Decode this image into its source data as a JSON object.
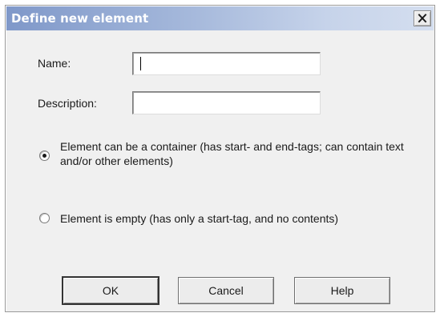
{
  "dialog": {
    "title": "Define new element"
  },
  "form": {
    "name_label": "Name:",
    "name_value": "",
    "description_label": "Description:",
    "description_value": ""
  },
  "options": [
    {
      "label": "Element can be a container (has start- and end-tags; can contain text and/or other elements)",
      "selected": true
    },
    {
      "label": "Element is empty (has only a start-tag, and no contents)",
      "selected": false
    }
  ],
  "buttons": {
    "ok": "OK",
    "cancel": "Cancel",
    "help": "Help"
  },
  "icons": {
    "close": "close-icon"
  }
}
